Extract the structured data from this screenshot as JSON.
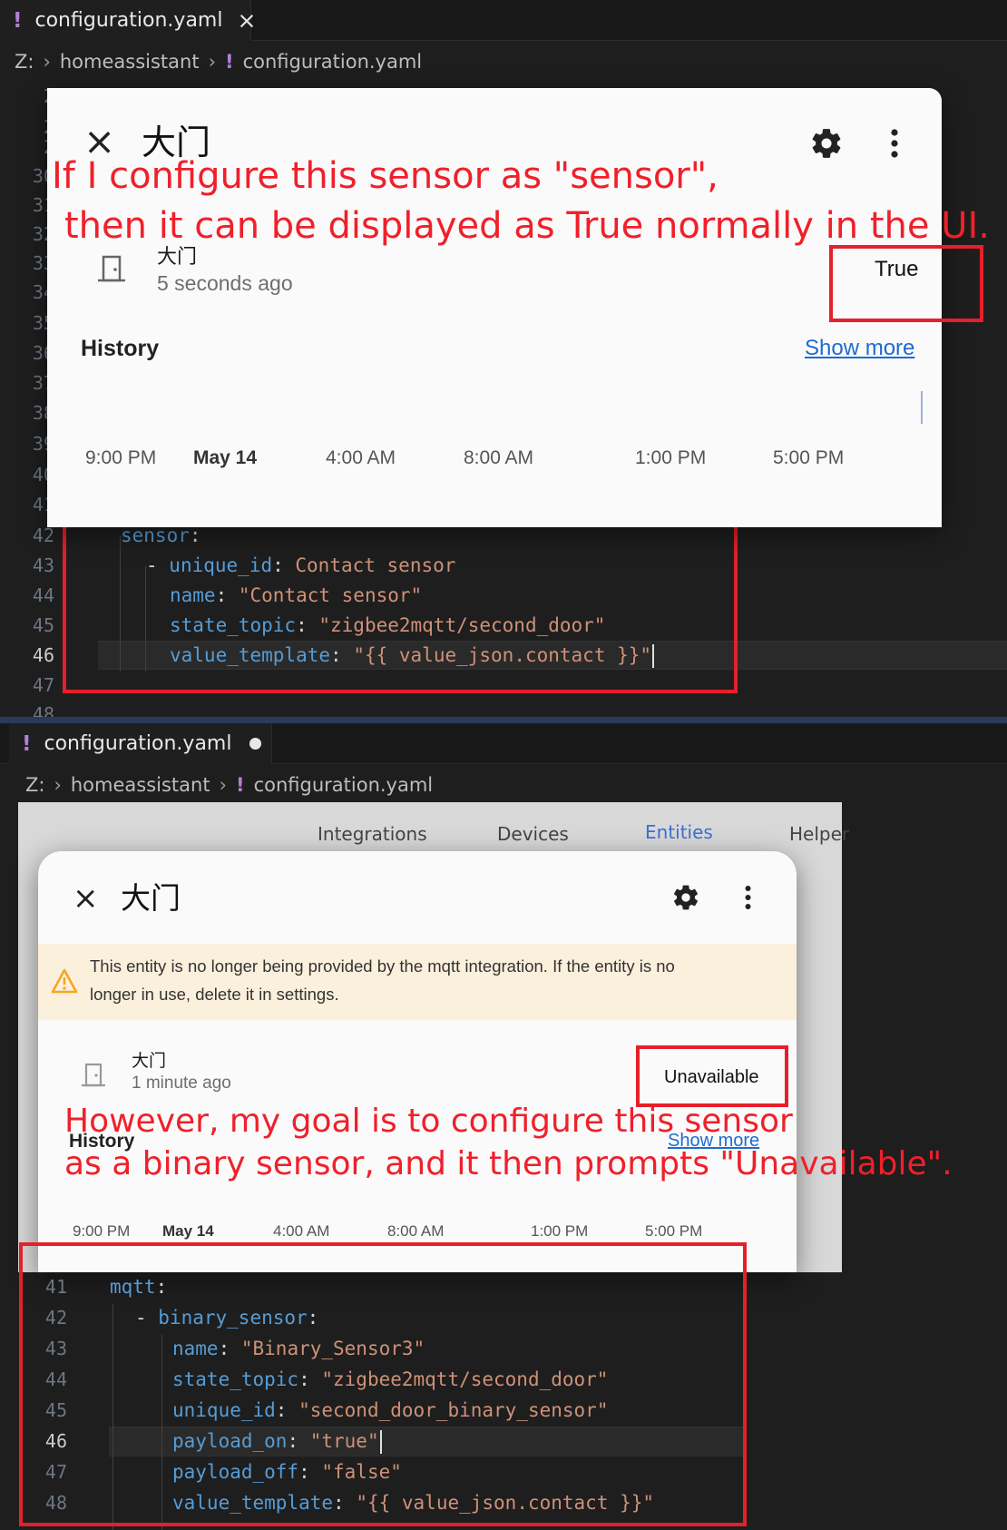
{
  "top": {
    "tab": {
      "icon": "!",
      "filename": "configuration.yaml",
      "close": "×"
    },
    "breadcrumb": {
      "drive": "Z:",
      "folder": "homeassistant",
      "icon": "!",
      "file": "configuration.yaml"
    },
    "gutter": [
      "2",
      "2",
      "2",
      "30",
      "31",
      "32",
      "33",
      "34",
      "35",
      "36",
      "37",
      "38",
      "39",
      "40",
      "41",
      "42",
      "43",
      "44",
      "45",
      "46",
      "47",
      "48"
    ],
    "code": [
      {
        "t1": "sensor",
        "t2": ":"
      },
      {
        "dash": "- ",
        "key": "unique_id",
        "colon": ": ",
        "val": "Contact sensor"
      },
      {
        "key": "name",
        "colon": ": ",
        "val": "\"Contact sensor\""
      },
      {
        "key": "state_topic",
        "colon": ": ",
        "val": "\"zigbee2mqtt/second_door\""
      },
      {
        "key": "value_template",
        "colon": ": ",
        "val": "\"{{ value_json.contact }}\""
      }
    ],
    "dialog": {
      "close": "×",
      "title": "大门",
      "gear_icon": "gear-icon",
      "more_icon": "more-vert-icon",
      "entity_name": "大门",
      "entity_time": "5 seconds ago",
      "state": "True",
      "history_label": "History",
      "show_more": "Show more",
      "axis": [
        "9:00 PM",
        "May 14",
        "4:00 AM",
        "8:00 AM",
        "1:00 PM",
        "5:00 PM"
      ]
    },
    "annotation": [
      "If I configure this sensor as \"sensor\",",
      "then it can be displayed as True normally in the UI."
    ]
  },
  "bottom": {
    "tab": {
      "icon": "!",
      "filename": "configuration.yaml"
    },
    "breadcrumb": {
      "drive": "Z:",
      "folder": "homeassistant",
      "icon": "!",
      "file": "configuration.yaml"
    },
    "nav_tabs": [
      "Integrations",
      "Devices",
      "Entities",
      "Helper"
    ],
    "dialog": {
      "close": "×",
      "title": "大门",
      "warning": "This entity is no longer being provided by the mqtt integration. If the entity is no longer in use, delete it in settings.",
      "warning_line1": "This entity is no longer being provided by the mqtt integration. If the entity is no",
      "warning_line2": "longer in use, delete it in settings.",
      "entity_name": "大门",
      "entity_time": "1 minute ago",
      "state": "Unavailable",
      "history_label": "History",
      "show_more": "Show more",
      "axis": [
        "9:00 PM",
        "May 14",
        "4:00 AM",
        "8:00 AM",
        "1:00 PM",
        "5:00 PM"
      ]
    },
    "annotation": [
      "However, my goal is to configure this sensor",
      "as a binary sensor, and it then prompts \"Unavailable\"."
    ],
    "gutter": [
      "41",
      "42",
      "43",
      "44",
      "45",
      "46",
      "47",
      "48"
    ],
    "code": [
      {
        "key": "mqtt",
        "colon": ":"
      },
      {
        "dash": "- ",
        "key": "binary_sensor",
        "colon": ":"
      },
      {
        "key": "name",
        "colon": ": ",
        "val": "\"Binary_Sensor3\""
      },
      {
        "key": "state_topic",
        "colon": ": ",
        "val": "\"zigbee2mqtt/second_door\""
      },
      {
        "key": "unique_id",
        "colon": ": ",
        "val": "\"second_door_binary_sensor\""
      },
      {
        "key": "payload_on",
        "colon": ": ",
        "val": "\"true\""
      },
      {
        "key": "payload_off",
        "colon": ": ",
        "val": "\"false\""
      },
      {
        "key": "value_template",
        "colon": ": ",
        "val": "\"{{ value_json.contact }}\""
      }
    ]
  },
  "colors": {
    "annotation_red": "#e5202a",
    "yaml_key": "#569cd6",
    "yaml_string": "#ce9178",
    "link_blue": "#1e6bd2"
  }
}
